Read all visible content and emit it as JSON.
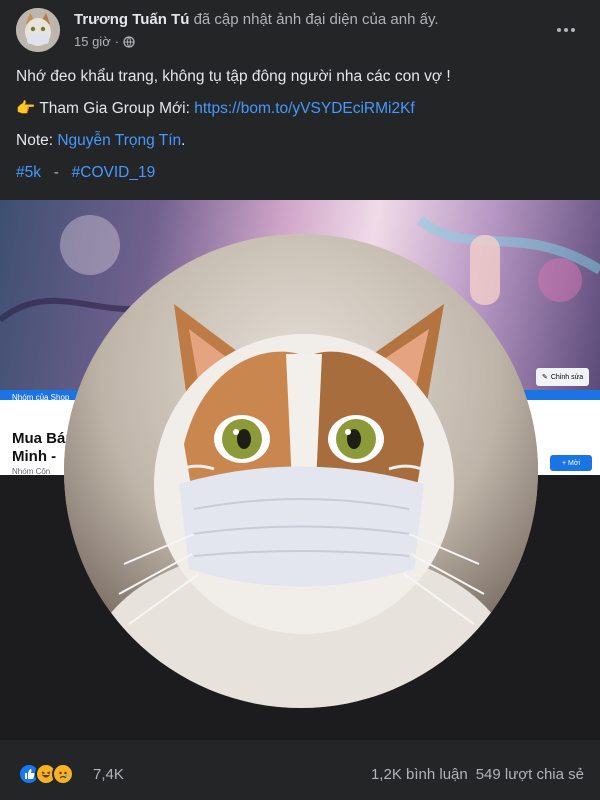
{
  "post": {
    "author": "Trương Tuấn Tú",
    "action": "đã cập nhật ảnh đại diện của anh ấy.",
    "time": "15 giờ",
    "lines": {
      "line1": "Nhớ đeo khẩu trang, không tụ tập đông người nha các con vợ  !",
      "line2_prefix": "Tham Gia Group Mới: ",
      "line2_link": "https://bom.to/yVSYDEciRMi2Kf",
      "line3_prefix": "Note: ",
      "line3_mention": "Nguyễn Trọng Tín",
      "line3_suffix": ".",
      "hashtag1": "#5k",
      "separator": "-",
      "hashtag2": "#COVID_19"
    }
  },
  "cover": {
    "group_label": "Nhóm của Shop",
    "title_line1": "Mua Bán",
    "title_line2": "Minh -",
    "sub": "Nhóm Côn",
    "edit_label": "Chỉnh sửa",
    "join_label": "+ Mời"
  },
  "footer": {
    "reaction_count": "7,4K",
    "comments": "1,2K bình luận",
    "shares": "549 lượt chia sẻ"
  },
  "icons": {
    "globe": "globe-icon",
    "more": "more-options-icon",
    "hand": "pointing-hand-icon",
    "like": "like-reaction-icon",
    "haha": "haha-reaction-icon",
    "sad": "sad-reaction-icon"
  },
  "colors": {
    "background": "#242526",
    "link": "#4599ff",
    "text": "#e4e6eb",
    "muted": "#b0b3b8"
  }
}
